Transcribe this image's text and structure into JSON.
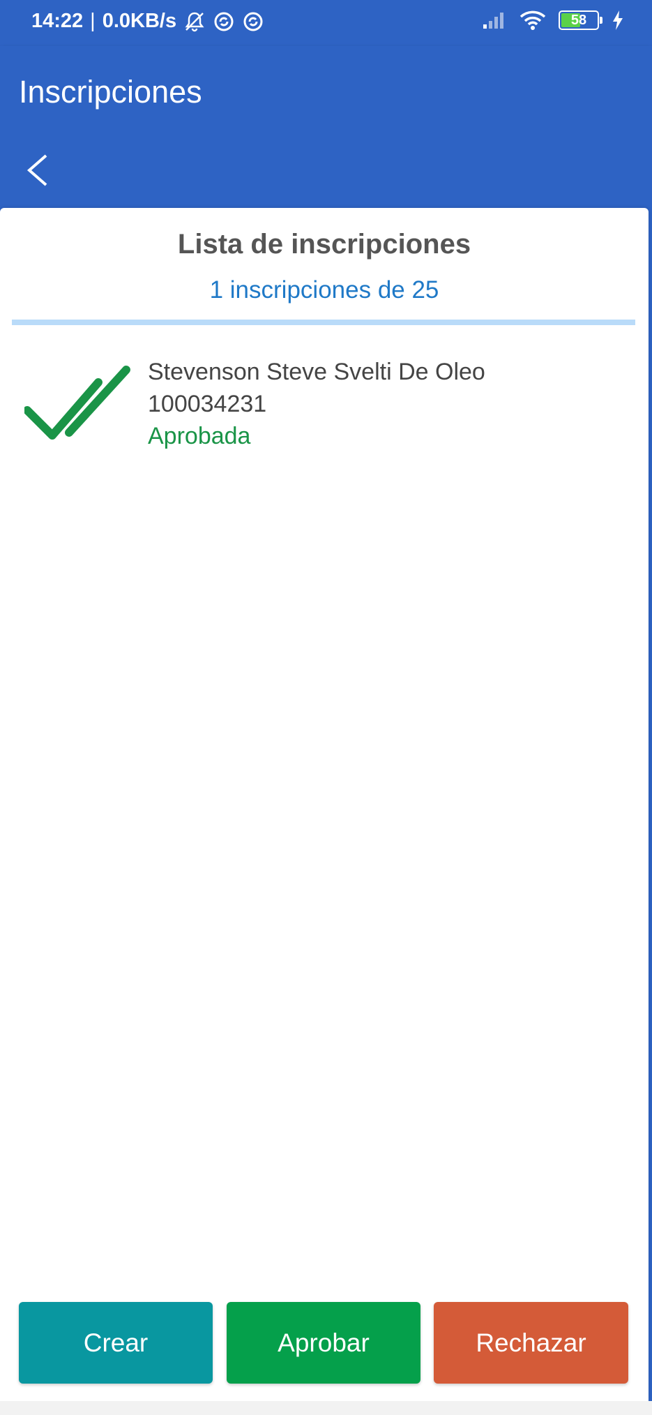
{
  "status_bar": {
    "time": "14:22",
    "separator": "|",
    "network_speed": "0.0KB/s",
    "battery_level": "58",
    "battery_fraction": 0.58,
    "icons": [
      "notifications-off-icon",
      "sync-icon",
      "sync-icon",
      "signal-icon",
      "wifi-icon",
      "battery-icon",
      "charging-icon"
    ]
  },
  "app_bar": {
    "title": "Inscripciones"
  },
  "navigation": {
    "back_icon": "chevron-left-icon"
  },
  "list": {
    "title": "Lista de inscripciones",
    "count_text": "1 inscripciones de 25",
    "items": [
      {
        "name": "Stevenson Steve Svelti De Oleo",
        "id": "100034231",
        "status": "Aprobada",
        "icon": "double-check-icon"
      }
    ]
  },
  "actions": {
    "create_label": "Crear",
    "approve_label": "Aprobar",
    "reject_label": "Rechazar"
  },
  "colors": {
    "primary": "#2e63c4",
    "count_text": "#1f79c7",
    "approved": "#1a9447",
    "create_button": "#0997a0",
    "approve_button": "#05a04b",
    "reject_button": "#d45b38"
  }
}
